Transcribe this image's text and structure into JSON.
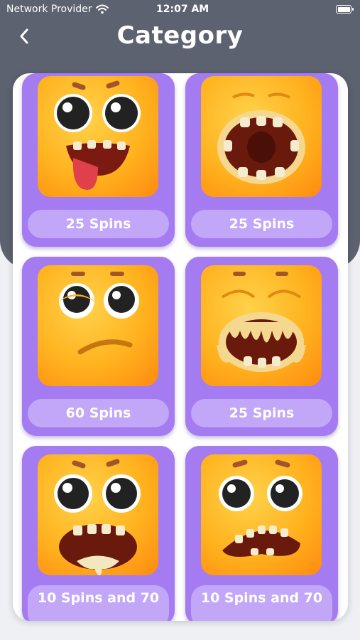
{
  "status_bar": {
    "carrier": "Network Provider",
    "time": "12:07 AM",
    "battery_level": 1.0
  },
  "header": {
    "title": "Category",
    "back_icon": "chevron-left-icon"
  },
  "colors": {
    "header_bg": "#5d6270",
    "card_bg": "#a47bf0",
    "label_bg": "#c2a6f7",
    "face_orange": "#ffb21e"
  },
  "categories": [
    {
      "label": "25 Spins",
      "face": "tongue-out-face-icon"
    },
    {
      "label": "25 Spins",
      "face": "open-mouth-face-icon"
    },
    {
      "label": "60 Spins",
      "face": "skeptical-face-icon"
    },
    {
      "label": "25 Spins",
      "face": "melting-teeth-face-icon"
    },
    {
      "label": "10 Spins and 70",
      "face": "drooling-face-icon"
    },
    {
      "label": "10 Spins and 70",
      "face": "grimace-face-icon"
    }
  ]
}
